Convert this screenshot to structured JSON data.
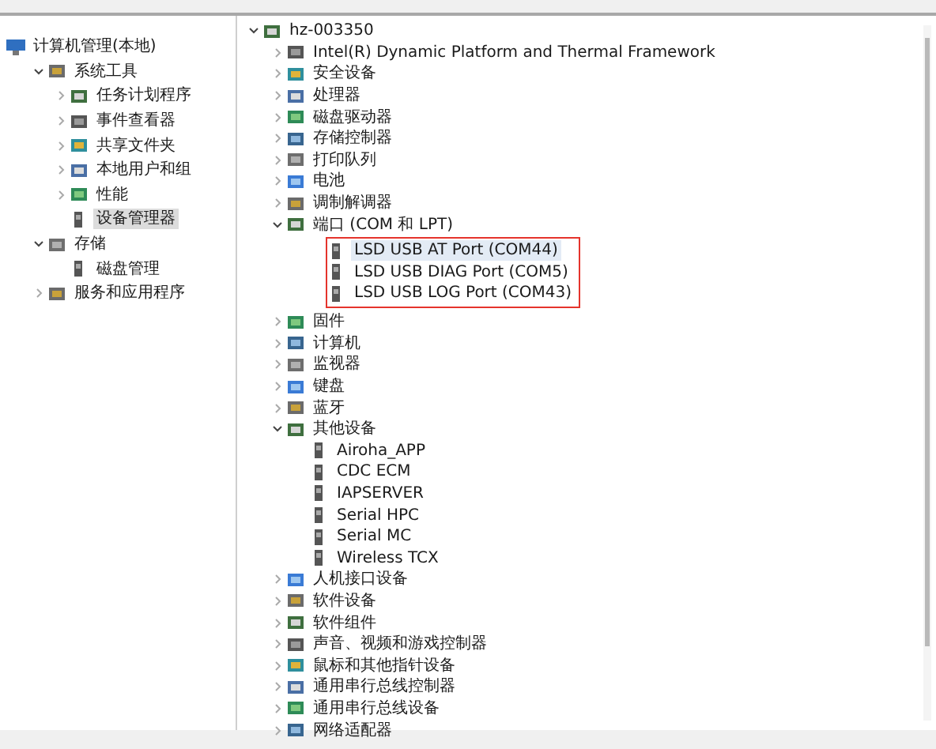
{
  "navigation_tree": [
    {
      "label": "计算机管理(本地)",
      "kind": "root",
      "selected": false,
      "children": [
        {
          "label": "系统工具",
          "kind": "node",
          "expanded": true,
          "selected": false,
          "children": [
            {
              "label": "任务计划程序",
              "kind": "node",
              "expanded": false,
              "selected": false
            },
            {
              "label": "事件查看器",
              "kind": "node",
              "expanded": false,
              "selected": false
            },
            {
              "label": "共享文件夹",
              "kind": "node",
              "expanded": false,
              "selected": false
            },
            {
              "label": "本地用户和组",
              "kind": "node",
              "expanded": false,
              "selected": false
            },
            {
              "label": "性能",
              "kind": "node",
              "expanded": false,
              "selected": false
            },
            {
              "label": "设备管理器",
              "kind": "leaf",
              "selected": true
            }
          ]
        },
        {
          "label": "存储",
          "kind": "node",
          "expanded": true,
          "selected": false,
          "children": [
            {
              "label": "磁盘管理",
              "kind": "leaf",
              "selected": false
            }
          ]
        },
        {
          "label": "服务和应用程序",
          "kind": "node",
          "expanded": false,
          "selected": false
        }
      ]
    }
  ],
  "device_tree": [
    {
      "label": "hz-003350",
      "kind": "node",
      "expanded": true,
      "selected": false,
      "children": [
        {
          "label": "Intel(R) Dynamic Platform and Thermal Framework",
          "kind": "node",
          "expanded": false,
          "selected": false
        },
        {
          "label": "安全设备",
          "kind": "node",
          "expanded": false,
          "selected": false
        },
        {
          "label": "处理器",
          "kind": "node",
          "expanded": false,
          "selected": false
        },
        {
          "label": "磁盘驱动器",
          "kind": "node",
          "expanded": false,
          "selected": false
        },
        {
          "label": "存储控制器",
          "kind": "node",
          "expanded": false,
          "selected": false
        },
        {
          "label": "打印队列",
          "kind": "node",
          "expanded": false,
          "selected": false
        },
        {
          "label": "电池",
          "kind": "node",
          "expanded": false,
          "selected": false
        },
        {
          "label": "调制解调器",
          "kind": "node",
          "expanded": false,
          "selected": false
        },
        {
          "label": "端口 (COM 和 LPT)",
          "kind": "node",
          "expanded": true,
          "selected": false,
          "children": [
            {
              "label": "LSD USB AT Port (COM44)",
              "kind": "leaf",
              "selected": true,
              "outlined": true
            },
            {
              "label": "LSD USB DIAG Port (COM5)",
              "kind": "leaf",
              "selected": false,
              "outlined": true
            },
            {
              "label": "LSD USB LOG Port (COM43)",
              "kind": "leaf",
              "selected": false,
              "outlined": true
            }
          ]
        },
        {
          "label": "固件",
          "kind": "node",
          "expanded": false,
          "selected": false
        },
        {
          "label": "计算机",
          "kind": "node",
          "expanded": false,
          "selected": false
        },
        {
          "label": "监视器",
          "kind": "node",
          "expanded": false,
          "selected": false
        },
        {
          "label": "键盘",
          "kind": "node",
          "expanded": false,
          "selected": false
        },
        {
          "label": "蓝牙",
          "kind": "node",
          "expanded": false,
          "selected": false
        },
        {
          "label": "其他设备",
          "kind": "node",
          "expanded": true,
          "selected": false,
          "children": [
            {
              "label": "Airoha_APP",
              "kind": "leaf",
              "selected": false
            },
            {
              "label": "CDC ECM",
              "kind": "leaf",
              "selected": false
            },
            {
              "label": "IAPSERVER",
              "kind": "leaf",
              "selected": false
            },
            {
              "label": "Serial HPC",
              "kind": "leaf",
              "selected": false
            },
            {
              "label": "Serial MC",
              "kind": "leaf",
              "selected": false
            },
            {
              "label": "Wireless TCX",
              "kind": "leaf",
              "selected": false
            }
          ]
        },
        {
          "label": "人机接口设备",
          "kind": "node",
          "expanded": false,
          "selected": false
        },
        {
          "label": "软件设备",
          "kind": "node",
          "expanded": false,
          "selected": false
        },
        {
          "label": "软件组件",
          "kind": "node",
          "expanded": false,
          "selected": false
        },
        {
          "label": "声音、视频和游戏控制器",
          "kind": "node",
          "expanded": false,
          "selected": false
        },
        {
          "label": "鼠标和其他指针设备",
          "kind": "node",
          "expanded": false,
          "selected": false
        },
        {
          "label": "通用串行总线控制器",
          "kind": "node",
          "expanded": false,
          "selected": false
        },
        {
          "label": "通用串行总线设备",
          "kind": "node",
          "expanded": false,
          "selected": false
        },
        {
          "label": "网络适配器",
          "kind": "node",
          "expanded": false,
          "selected": false
        }
      ]
    }
  ]
}
